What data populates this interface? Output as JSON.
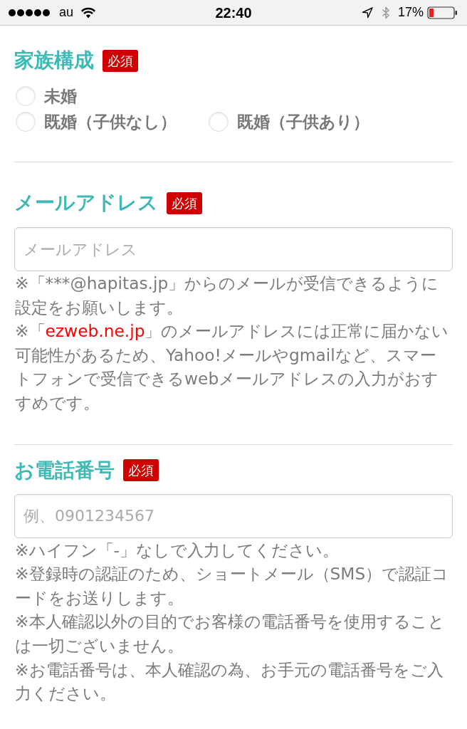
{
  "status_bar": {
    "carrier": "au",
    "time": "22:40",
    "battery": "17%"
  },
  "sections": [
    {
      "kind": "radio",
      "title": "家族構成",
      "badge": "必須",
      "option_rows": [
        [
          {
            "label": "未婚",
            "selected": false
          }
        ],
        [
          {
            "label": "既婚（子供なし）",
            "selected": false
          },
          {
            "label": "既婚（子供あり）",
            "selected": false
          }
        ]
      ]
    },
    {
      "kind": "text-input",
      "title": "メールアドレス",
      "badge": "必須",
      "field": {
        "placeholder": "メールアドレス"
      },
      "notes": [
        {
          "parts": [
            {
              "text": "※「***@hapitas.jp」からのメールが受信できるように設定をお願いします。",
              "highlight": false
            }
          ]
        },
        {
          "parts": [
            {
              "text": "※「",
              "highlight": false
            },
            {
              "text": "ezweb.ne.jp",
              "highlight": true
            },
            {
              "text": "」のメールアドレスには正常に届かない可能性があるため、Yahoo!メールやgmailなど、スマートフォンで受信できるwebメールアドレスの入力がおすすめです。",
              "highlight": false
            }
          ]
        }
      ]
    },
    {
      "kind": "text-input",
      "title": "お電話番号",
      "badge": "必須",
      "field": {
        "placeholder": "例、0901234567"
      },
      "notes": [
        {
          "parts": [
            {
              "text": "※ハイフン「-」なしで入力してください。",
              "highlight": false
            }
          ]
        },
        {
          "parts": [
            {
              "text": "※登録時の認証のため、ショートメール（SMS）で認証コードをお送りします。",
              "highlight": false
            }
          ]
        },
        {
          "parts": [
            {
              "text": "※本人確認以外の目的でお客様の電話番号を使用することは一切ございません。",
              "highlight": false
            }
          ]
        },
        {
          "parts": [
            {
              "text": "※お電話番号は、本人確認の為、お手元の電話番号をご入力ください。",
              "highlight": false
            }
          ]
        }
      ]
    }
  ]
}
